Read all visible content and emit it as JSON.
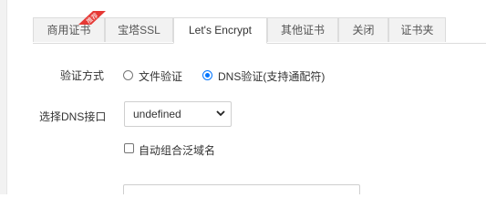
{
  "tabs": [
    {
      "label": "商用证书",
      "active": false,
      "badge": "推荐"
    },
    {
      "label": "宝塔SSL",
      "active": false
    },
    {
      "label": "Let's Encrypt",
      "active": true
    },
    {
      "label": "其他证书",
      "active": false
    },
    {
      "label": "关闭",
      "active": false
    },
    {
      "label": "证书夹",
      "active": false
    }
  ],
  "verify": {
    "label": "验证方式",
    "options": [
      {
        "label": "文件验证",
        "checked": false
      },
      {
        "label": "DNS验证(支持通配符)",
        "checked": true
      }
    ]
  },
  "dns": {
    "label": "选择DNS接口",
    "selected": "undefined"
  },
  "wildcard": {
    "label": "自动组合泛域名",
    "checked": false
  },
  "colors": {
    "ribbon": "#e53935",
    "radio_selected": "#0075ff",
    "tab_border": "#dcdcdc",
    "tab_inactive_bg": "#f2f2f2"
  },
  "icons": {
    "ribbon": "recommend-ribbon-icon",
    "select": "chevron-down-icon"
  }
}
